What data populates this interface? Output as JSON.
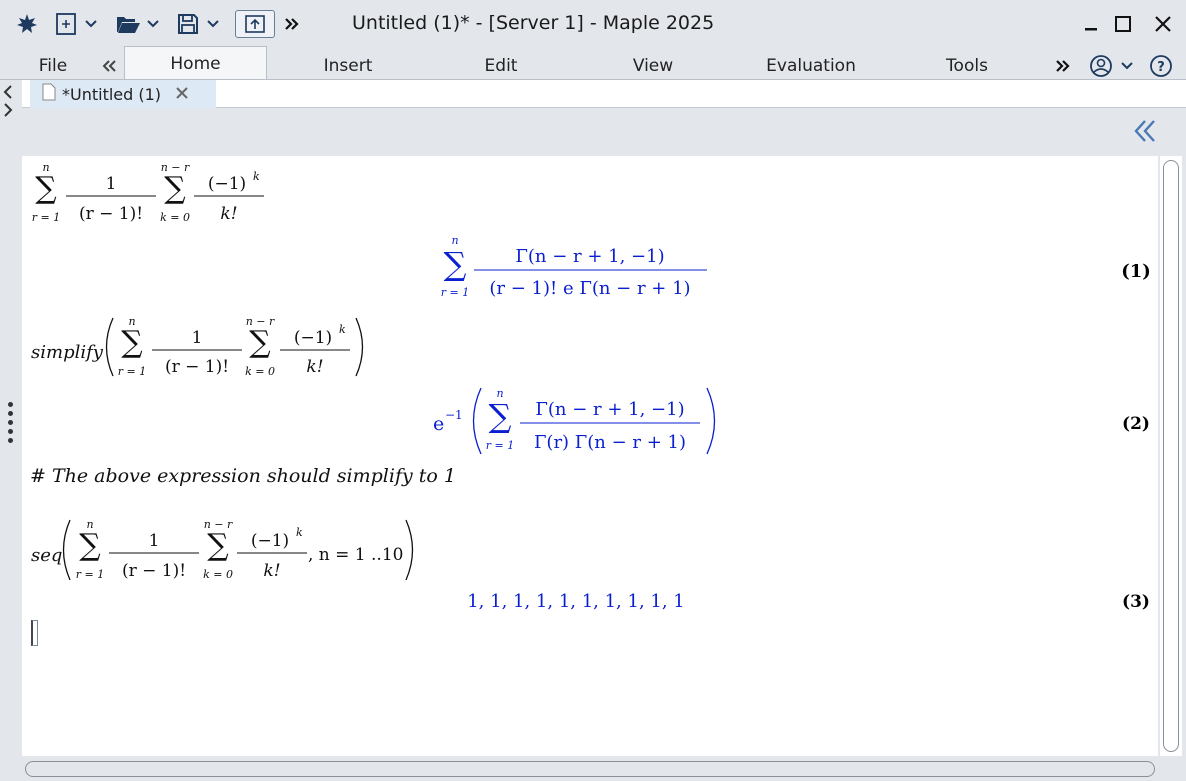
{
  "window": {
    "title": "Untitled (1)* - [Server 1] - Maple 2025"
  },
  "ribbon": {
    "tabs": [
      {
        "label": "File"
      },
      {
        "label": "Home"
      },
      {
        "label": "Insert"
      },
      {
        "label": "Edit"
      },
      {
        "label": "View"
      },
      {
        "label": "Evaluation"
      },
      {
        "label": "Tools"
      }
    ],
    "active_tab": "Home"
  },
  "document_tab": {
    "label": "*Untitled (1)"
  },
  "worksheet": {
    "input1": {
      "sum_lower": "r = 1",
      "sum_upper": "n",
      "frac1_num": "1",
      "frac1_den": "(r − 1)!",
      "sum2_lower": "k = 0",
      "sum2_upper": "n − r",
      "frac2_num": "(−1)",
      "frac2_exp": "k",
      "frac2_den": "k!"
    },
    "output1": {
      "sum_lower": "r = 1",
      "sum_upper": "n",
      "num": "Γ(n − r + 1, −1)",
      "den": "(r − 1)! e Γ(n − r + 1)",
      "label": "(1)"
    },
    "input2": {
      "func": "simplify",
      "sum_lower": "r = 1",
      "sum_upper": "n",
      "frac1_num": "1",
      "frac1_den": "(r − 1)!",
      "sum2_lower": "k = 0",
      "sum2_upper": "n − r",
      "frac2_num": "(−1)",
      "frac2_exp": "k",
      "frac2_den": "k!"
    },
    "output2": {
      "prefix": "e",
      "prefix_exp": "−1",
      "sum_lower": "r = 1",
      "sum_upper": "n",
      "num": "Γ(n − r + 1, −1)",
      "den": "Γ(r) Γ(n − r + 1)",
      "label": "(2)"
    },
    "comment": "# The above expression should simplify to 1",
    "input3": {
      "func": "seq",
      "sum_lower": "r = 1",
      "sum_upper": "n",
      "frac1_num": "1",
      "frac1_den": "(r − 1)!",
      "sum2_lower": "k = 0",
      "sum2_upper": "n − r",
      "frac2_num": "(−1)",
      "frac2_exp": "k",
      "frac2_den": "k!",
      "range": ", n = 1 ..10"
    },
    "output3": {
      "value": "1, 1, 1, 1, 1, 1, 1, 1, 1, 1",
      "label": "(3)"
    }
  },
  "colors": {
    "output_blue": "#0a1fd0",
    "input_black": "#111111",
    "doc_tab_bg": "#dde9f5"
  }
}
